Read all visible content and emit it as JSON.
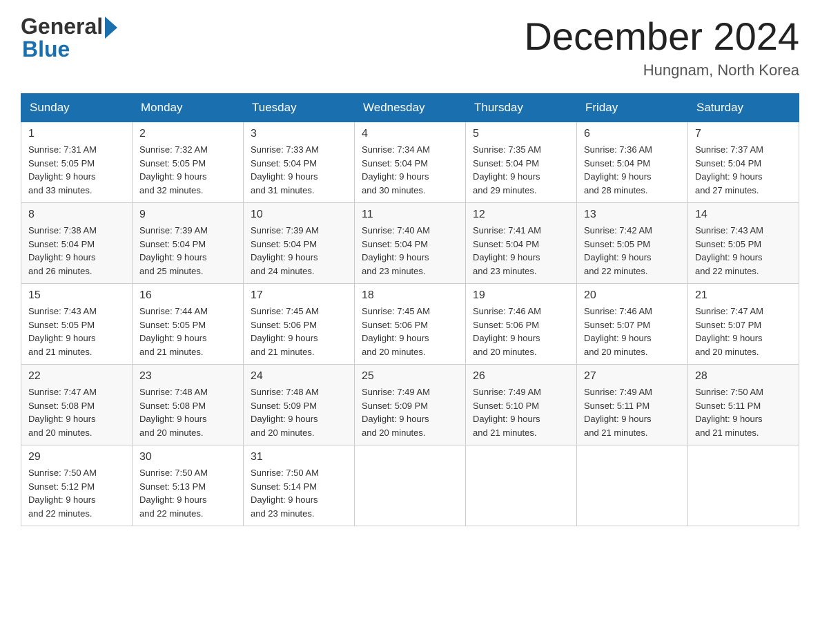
{
  "header": {
    "logo_general": "General",
    "logo_blue": "Blue",
    "month_title": "December 2024",
    "location": "Hungnam, North Korea"
  },
  "days_of_week": [
    "Sunday",
    "Monday",
    "Tuesday",
    "Wednesday",
    "Thursday",
    "Friday",
    "Saturday"
  ],
  "weeks": [
    [
      {
        "num": "1",
        "sunrise": "7:31 AM",
        "sunset": "5:05 PM",
        "daylight": "9 hours and 33 minutes."
      },
      {
        "num": "2",
        "sunrise": "7:32 AM",
        "sunset": "5:05 PM",
        "daylight": "9 hours and 32 minutes."
      },
      {
        "num": "3",
        "sunrise": "7:33 AM",
        "sunset": "5:04 PM",
        "daylight": "9 hours and 31 minutes."
      },
      {
        "num": "4",
        "sunrise": "7:34 AM",
        "sunset": "5:04 PM",
        "daylight": "9 hours and 30 minutes."
      },
      {
        "num": "5",
        "sunrise": "7:35 AM",
        "sunset": "5:04 PM",
        "daylight": "9 hours and 29 minutes."
      },
      {
        "num": "6",
        "sunrise": "7:36 AM",
        "sunset": "5:04 PM",
        "daylight": "9 hours and 28 minutes."
      },
      {
        "num": "7",
        "sunrise": "7:37 AM",
        "sunset": "5:04 PM",
        "daylight": "9 hours and 27 minutes."
      }
    ],
    [
      {
        "num": "8",
        "sunrise": "7:38 AM",
        "sunset": "5:04 PM",
        "daylight": "9 hours and 26 minutes."
      },
      {
        "num": "9",
        "sunrise": "7:39 AM",
        "sunset": "5:04 PM",
        "daylight": "9 hours and 25 minutes."
      },
      {
        "num": "10",
        "sunrise": "7:39 AM",
        "sunset": "5:04 PM",
        "daylight": "9 hours and 24 minutes."
      },
      {
        "num": "11",
        "sunrise": "7:40 AM",
        "sunset": "5:04 PM",
        "daylight": "9 hours and 23 minutes."
      },
      {
        "num": "12",
        "sunrise": "7:41 AM",
        "sunset": "5:04 PM",
        "daylight": "9 hours and 23 minutes."
      },
      {
        "num": "13",
        "sunrise": "7:42 AM",
        "sunset": "5:05 PM",
        "daylight": "9 hours and 22 minutes."
      },
      {
        "num": "14",
        "sunrise": "7:43 AM",
        "sunset": "5:05 PM",
        "daylight": "9 hours and 22 minutes."
      }
    ],
    [
      {
        "num": "15",
        "sunrise": "7:43 AM",
        "sunset": "5:05 PM",
        "daylight": "9 hours and 21 minutes."
      },
      {
        "num": "16",
        "sunrise": "7:44 AM",
        "sunset": "5:05 PM",
        "daylight": "9 hours and 21 minutes."
      },
      {
        "num": "17",
        "sunrise": "7:45 AM",
        "sunset": "5:06 PM",
        "daylight": "9 hours and 21 minutes."
      },
      {
        "num": "18",
        "sunrise": "7:45 AM",
        "sunset": "5:06 PM",
        "daylight": "9 hours and 20 minutes."
      },
      {
        "num": "19",
        "sunrise": "7:46 AM",
        "sunset": "5:06 PM",
        "daylight": "9 hours and 20 minutes."
      },
      {
        "num": "20",
        "sunrise": "7:46 AM",
        "sunset": "5:07 PM",
        "daylight": "9 hours and 20 minutes."
      },
      {
        "num": "21",
        "sunrise": "7:47 AM",
        "sunset": "5:07 PM",
        "daylight": "9 hours and 20 minutes."
      }
    ],
    [
      {
        "num": "22",
        "sunrise": "7:47 AM",
        "sunset": "5:08 PM",
        "daylight": "9 hours and 20 minutes."
      },
      {
        "num": "23",
        "sunrise": "7:48 AM",
        "sunset": "5:08 PM",
        "daylight": "9 hours and 20 minutes."
      },
      {
        "num": "24",
        "sunrise": "7:48 AM",
        "sunset": "5:09 PM",
        "daylight": "9 hours and 20 minutes."
      },
      {
        "num": "25",
        "sunrise": "7:49 AM",
        "sunset": "5:09 PM",
        "daylight": "9 hours and 20 minutes."
      },
      {
        "num": "26",
        "sunrise": "7:49 AM",
        "sunset": "5:10 PM",
        "daylight": "9 hours and 21 minutes."
      },
      {
        "num": "27",
        "sunrise": "7:49 AM",
        "sunset": "5:11 PM",
        "daylight": "9 hours and 21 minutes."
      },
      {
        "num": "28",
        "sunrise": "7:50 AM",
        "sunset": "5:11 PM",
        "daylight": "9 hours and 21 minutes."
      }
    ],
    [
      {
        "num": "29",
        "sunrise": "7:50 AM",
        "sunset": "5:12 PM",
        "daylight": "9 hours and 22 minutes."
      },
      {
        "num": "30",
        "sunrise": "7:50 AM",
        "sunset": "5:13 PM",
        "daylight": "9 hours and 22 minutes."
      },
      {
        "num": "31",
        "sunrise": "7:50 AM",
        "sunset": "5:14 PM",
        "daylight": "9 hours and 23 minutes."
      },
      null,
      null,
      null,
      null
    ]
  ],
  "labels": {
    "sunrise": "Sunrise:",
    "sunset": "Sunset:",
    "daylight": "Daylight:"
  }
}
